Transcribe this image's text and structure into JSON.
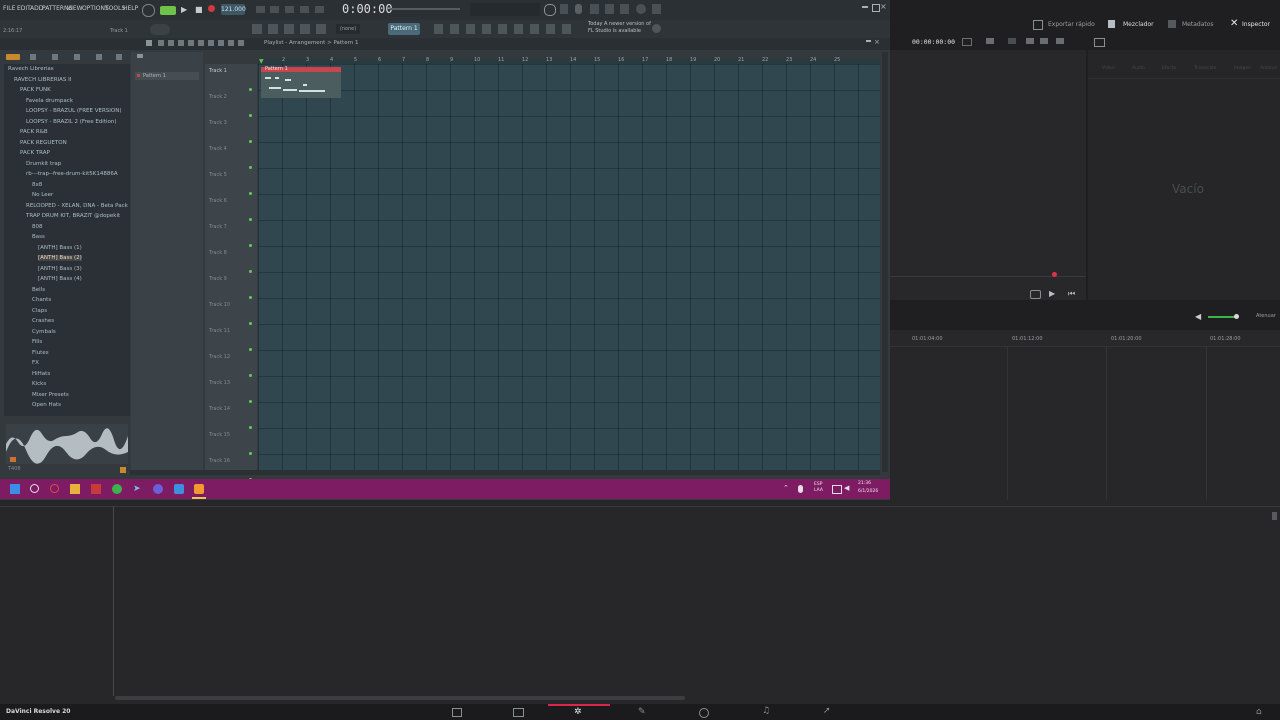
{
  "fl": {
    "menu": [
      "FILE",
      "EDIT",
      "ADD",
      "PATTERNS",
      "VIEW",
      "OPTIONS",
      "TOOLS",
      "HELP"
    ],
    "info_left": "2:16:17",
    "track_label": "Track 1",
    "time_display": "0:00:00",
    "bpm": "121.000",
    "pattern_selector": "Pattern 1",
    "snap_selector": "(none)",
    "notice_line1": "Today  A newer version of",
    "notice_line2": "FL Studio is available",
    "playlist_title": "Playlist - Arrangement > Pattern 1",
    "channel_pattern": "Pattern 1",
    "clip_label": "Pattern 1",
    "browser_items": [
      {
        "label": "Ravech Librerias",
        "indent": 0
      },
      {
        "label": "RAVECH LIBRERIAS II",
        "indent": 1
      },
      {
        "label": "PACK FUNK",
        "indent": 2
      },
      {
        "label": "Favela drumpack",
        "indent": 3
      },
      {
        "label": "LOOPSY - BRAZUL (FREE VERSION)",
        "indent": 3
      },
      {
        "label": "LOOPSY - BRAZIL 2 (Free Edition)",
        "indent": 3
      },
      {
        "label": "PACK R&B",
        "indent": 2
      },
      {
        "label": "PACK REGUETON",
        "indent": 2
      },
      {
        "label": "PACK TRAP",
        "indent": 2
      },
      {
        "label": "Drumkit trap",
        "indent": 3
      },
      {
        "label": "rb---trap--free-drum-kit5K14886A",
        "indent": 3
      },
      {
        "label": "8x8",
        "indent": 4
      },
      {
        "label": "No Leer",
        "indent": 4
      },
      {
        "label": "RELOOPED - XELAN, DNA - Beta Pack",
        "indent": 3
      },
      {
        "label": "TRAP DRUM KIT, BRAZIT @dopekit",
        "indent": 3
      },
      {
        "label": "808",
        "indent": 4
      },
      {
        "label": "Bass",
        "indent": 4
      },
      {
        "label": "[ANTH] Bass (1)",
        "indent": 5
      },
      {
        "label": "[ANTH] Bass (2)",
        "indent": 5
      },
      {
        "label": "[ANTH] Bass (3)",
        "indent": 5
      },
      {
        "label": "[ANTH] Bass (4)",
        "indent": 5
      },
      {
        "label": "Bells",
        "indent": 4
      },
      {
        "label": "Chants",
        "indent": 4
      },
      {
        "label": "Claps",
        "indent": 4
      },
      {
        "label": "Crashes",
        "indent": 4
      },
      {
        "label": "Cymbals",
        "indent": 4
      },
      {
        "label": "Fills",
        "indent": 4
      },
      {
        "label": "Flutes",
        "indent": 4
      },
      {
        "label": "FX",
        "indent": 4
      },
      {
        "label": "HiHats",
        "indent": 4
      },
      {
        "label": "Kicks",
        "indent": 4
      },
      {
        "label": "Mixer Presets",
        "indent": 4
      },
      {
        "label": "Open Hats",
        "indent": 4
      }
    ],
    "tracks": [
      "Track 1",
      "Track 2",
      "Track 3",
      "Track 4",
      "Track 5",
      "Track 6",
      "Track 7",
      "Track 8",
      "Track 9",
      "Track 10",
      "Track 11",
      "Track 12",
      "Track 13",
      "Track 14",
      "Track 15",
      "Track 16"
    ],
    "ruler": [
      "2",
      "3",
      "4",
      "5",
      "6",
      "7",
      "8",
      "9",
      "10",
      "11",
      "12",
      "13",
      "14",
      "15",
      "16",
      "17",
      "18",
      "19",
      "20",
      "21",
      "22",
      "23",
      "24",
      "25"
    ],
    "waveform_label": "T408",
    "taskbar_lang": "ESP\nLAA",
    "taskbar_time": "21:36",
    "taskbar_date": "6/1/2026"
  },
  "resolve": {
    "top_buttons": [
      "Exportar rápido",
      "Mezclador",
      "Metadatos",
      "Inspector"
    ],
    "timecode": "00:00:00:00",
    "empty_label": "Vacío",
    "attenuate_label": "Atenuar",
    "timeline_marks": [
      "01:01:04:00",
      "01:01:12:00",
      "01:01:20:00",
      "01:01:28:00"
    ],
    "app_title": "DaVinci Resolve 20",
    "inspector_tabs": [
      "Vídeo",
      "Audio",
      "Efecto",
      "Transición",
      "Imagen",
      "Archivo"
    ]
  },
  "colors": {
    "taskbar": "#7d1b63",
    "clip_header": "#c9454c",
    "grid_bg": "#30474f",
    "resolve_active_page": "#d9264a"
  }
}
